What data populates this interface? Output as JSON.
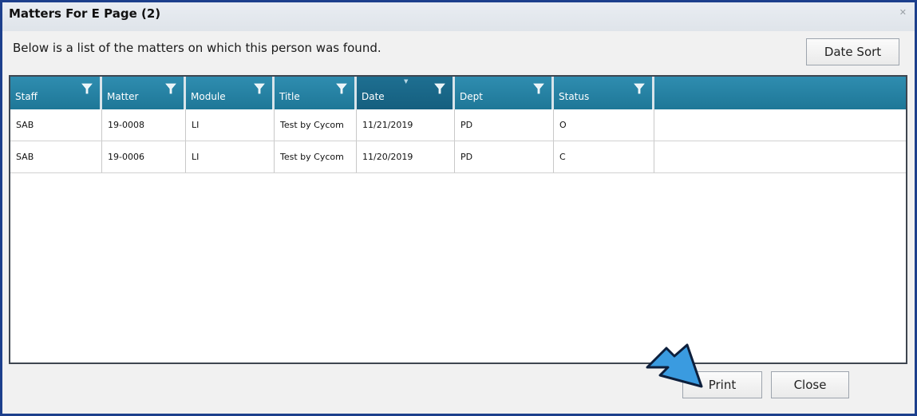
{
  "window": {
    "title": "Matters For E Page (2)",
    "close_glyph": "✕"
  },
  "description": "Below is a list of the matters on which this person was found.",
  "buttons": {
    "date_sort": "Date Sort",
    "print": "Print",
    "close": "Close"
  },
  "grid": {
    "columns": [
      "Staff",
      "Matter",
      "Module",
      "Title",
      "Date",
      "Dept",
      "Status"
    ],
    "sorted_column": "Date",
    "rows": [
      [
        "SAB",
        "19-0008",
        "LI",
        "Test by Cycom",
        "11/21/2019",
        "PD",
        "O"
      ],
      [
        "SAB",
        "19-0006",
        "LI",
        "Test by Cycom",
        "11/20/2019",
        "PD",
        "C"
      ]
    ]
  },
  "colors": {
    "header": "#2585a8",
    "frame_border": "#1c3f8c",
    "arrow": "#3a9be0"
  },
  "icons": {
    "filter": "filter-icon",
    "arrow": "pointer-arrow"
  }
}
